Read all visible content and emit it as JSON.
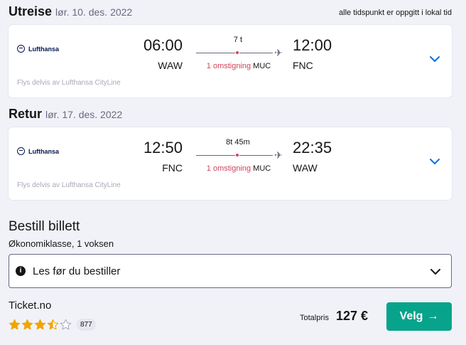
{
  "notice": "alle tidspunkt er oppgitt i lokal tid",
  "outbound": {
    "heading": "Utreise",
    "date": "lør. 10. des. 2022",
    "airline": "Lufthansa",
    "dep_time": "06:00",
    "dep_code": "WAW",
    "arr_time": "12:00",
    "arr_code": "FNC",
    "duration": "7 t",
    "stops": "1 omstigning",
    "via": "MUC",
    "operated_by": "Flys delvis av Lufthansa CityLine"
  },
  "return": {
    "heading": "Retur",
    "date": "lør. 17. des. 2022",
    "airline": "Lufthansa",
    "dep_time": "12:50",
    "dep_code": "FNC",
    "arr_time": "22:35",
    "arr_code": "WAW",
    "duration": "8t 45m",
    "stops": "1 omstigning",
    "via": "MUC",
    "operated_by": "Flys delvis av Lufthansa CityLine"
  },
  "booking": {
    "title": "Bestill billett",
    "subtitle": "Økonomiklasse, 1 voksen",
    "read_before": "Les før du bestiller",
    "provider": "Ticket.no",
    "rating": 3.5,
    "rating_max": 5,
    "review_count": "877",
    "total_label": "Totalpris",
    "total_price": "127 €",
    "select_label": "Velg"
  },
  "colors": {
    "accent_button": "#07a38b",
    "stop_marker": "#d1435b",
    "chevron": "#0770e3",
    "star": "#f0a500"
  },
  "icons": {
    "plane": "plane-icon",
    "chevron": "chevron-down-icon",
    "info": "info-icon",
    "arrow": "arrow-right-icon",
    "star": "star-icon"
  }
}
